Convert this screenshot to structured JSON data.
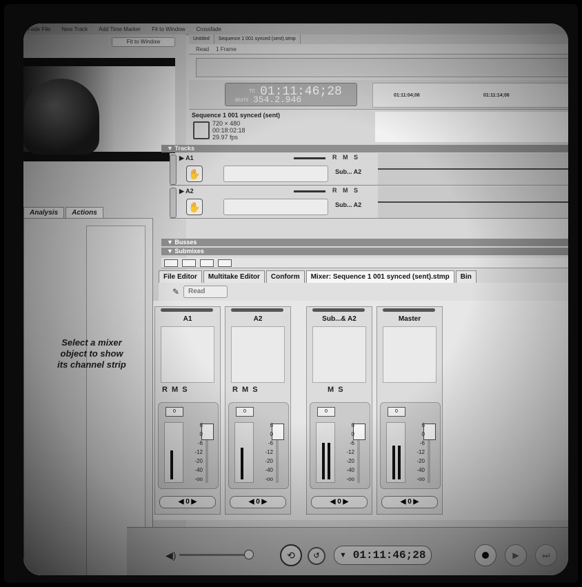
{
  "menubar": {
    "items": [
      "Fade File",
      "New Track",
      "Add Time Marker",
      "Fit to Window",
      "Crossfade"
    ]
  },
  "left": {
    "fit_label": "Fit to Window",
    "tabs": [
      "Analysis",
      "Actions"
    ],
    "select_message": "Select a mixer object to show its channel strip"
  },
  "top_tabs": [
    "Untitled",
    "Sequence 1 001 synced (sent).stmp"
  ],
  "toolbar": {
    "items": [
      "Read",
      "1 Frame"
    ]
  },
  "timecode": {
    "prefix": "TC",
    "main": "01:11:46;28",
    "beats_label": "BEATS",
    "beats": "354.2.946",
    "marks": [
      "01:11:04;06",
      "01:11:14;06"
    ]
  },
  "sequence": {
    "title": "Sequence 1 001 synced (sent)",
    "resolution": "720 × 480",
    "duration": "00:18:02:18",
    "fps": "29.97 fps"
  },
  "sections": {
    "tracks": "Tracks",
    "busses": "Busses",
    "submixes": "Submixes"
  },
  "tracks": [
    {
      "name": "A1",
      "rms": "R M S",
      "bus": "Sub... A2"
    },
    {
      "name": "A2",
      "rms": "R M S",
      "bus": "Sub... A2"
    }
  ],
  "main_tabs": [
    "File Editor",
    "Multitake Editor",
    "Conform",
    "Mixer: Sequence 1 001 synced (sent).stmp",
    "Bin"
  ],
  "automation": {
    "mode": "Read"
  },
  "strips": [
    {
      "name": "A1",
      "rms": "R M S",
      "pan": "0",
      "btn": "0",
      "level": 0.55
    },
    {
      "name": "A2",
      "rms": "R M S",
      "pan": "0",
      "btn": "0",
      "level": 0.6
    },
    {
      "name": "Sub...& A2",
      "rms": "M S",
      "pan": "0",
      "btn": "0",
      "level": 0.7
    },
    {
      "name": "Master",
      "rms": "",
      "pan": "0",
      "btn": "0",
      "level": 0.65
    }
  ],
  "scale_marks": [
    "6",
    "0",
    "-6",
    "-12",
    "-20",
    "-40",
    "-oo"
  ],
  "transport": {
    "timecode": "01:11:46;28"
  }
}
